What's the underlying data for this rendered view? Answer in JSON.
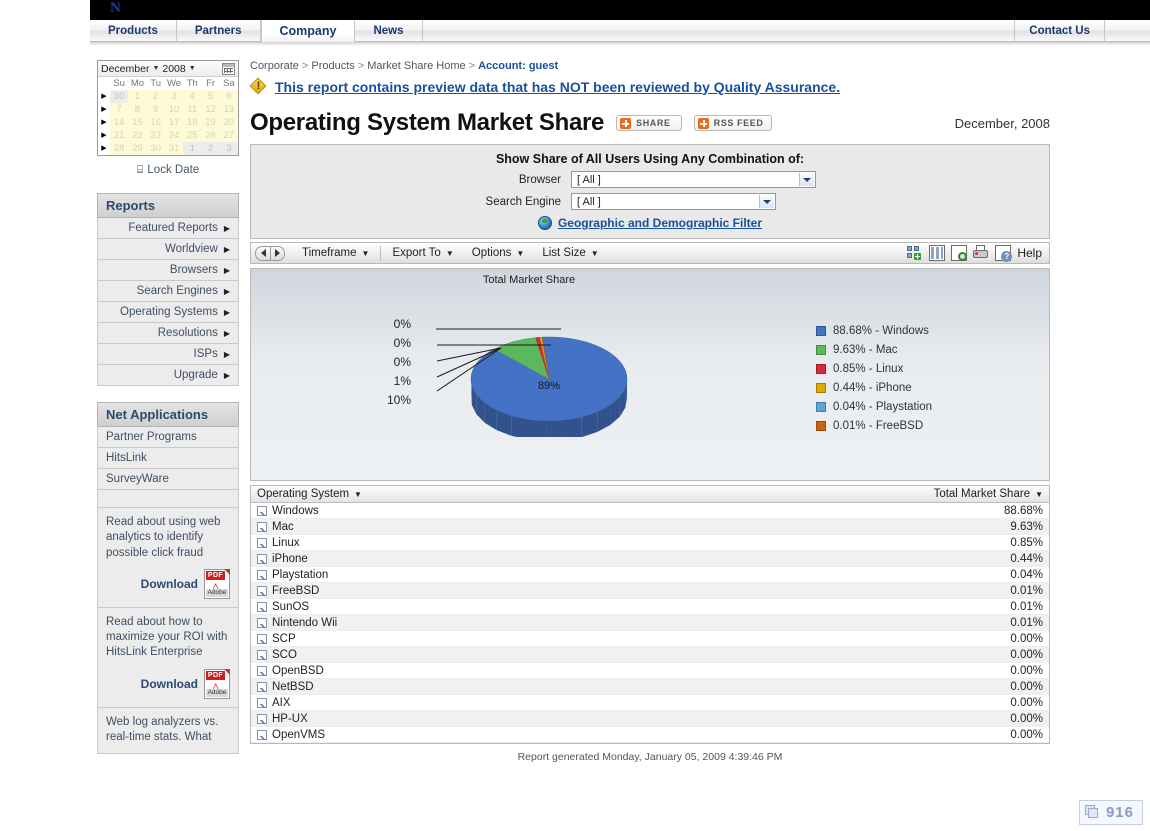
{
  "brand": {
    "logo_text": "N"
  },
  "nav": {
    "tabs": [
      {
        "label": "Products",
        "active": false
      },
      {
        "label": "Partners",
        "active": false
      },
      {
        "label": "Company",
        "active": true
      },
      {
        "label": "News",
        "active": false
      }
    ],
    "right_link": "Contact Us"
  },
  "calendar": {
    "month": "December",
    "year": "2008",
    "calendar_icon": "calendar-picker-icon",
    "dow": [
      "Su",
      "Mo",
      "Tu",
      "We",
      "Th",
      "Fr",
      "Sa"
    ],
    "weeks": [
      {
        "days": [
          {
            "d": "30",
            "out": true
          },
          {
            "d": "1",
            "out": false
          },
          {
            "d": "2",
            "out": false
          },
          {
            "d": "3",
            "out": false
          },
          {
            "d": "4",
            "out": false
          },
          {
            "d": "5",
            "out": false
          },
          {
            "d": "6",
            "out": false
          }
        ]
      },
      {
        "days": [
          {
            "d": "7",
            "out": false
          },
          {
            "d": "8",
            "out": false
          },
          {
            "d": "9",
            "out": false
          },
          {
            "d": "10",
            "out": false
          },
          {
            "d": "11",
            "out": false
          },
          {
            "d": "12",
            "out": false
          },
          {
            "d": "13",
            "out": false
          }
        ]
      },
      {
        "days": [
          {
            "d": "14",
            "out": false
          },
          {
            "d": "15",
            "out": false
          },
          {
            "d": "16",
            "out": false
          },
          {
            "d": "17",
            "out": false
          },
          {
            "d": "18",
            "out": false
          },
          {
            "d": "19",
            "out": false
          },
          {
            "d": "20",
            "out": false
          }
        ]
      },
      {
        "days": [
          {
            "d": "21",
            "out": false
          },
          {
            "d": "22",
            "out": false
          },
          {
            "d": "23",
            "out": false
          },
          {
            "d": "24",
            "out": false
          },
          {
            "d": "25",
            "out": false
          },
          {
            "d": "26",
            "out": false
          },
          {
            "d": "27",
            "out": false
          }
        ]
      },
      {
        "days": [
          {
            "d": "28",
            "out": false
          },
          {
            "d": "29",
            "out": false
          },
          {
            "d": "30",
            "out": false
          },
          {
            "d": "31",
            "out": false
          },
          {
            "d": "1",
            "out": true
          },
          {
            "d": "2",
            "out": true
          },
          {
            "d": "3",
            "out": true
          }
        ]
      }
    ],
    "lock_date_label": "Lock Date"
  },
  "sidebar": {
    "reports": {
      "title": "Reports",
      "items": [
        {
          "label": "Featured Reports"
        },
        {
          "label": "Worldview"
        },
        {
          "label": "Browsers"
        },
        {
          "label": "Search Engines"
        },
        {
          "label": "Operating Systems"
        },
        {
          "label": "Resolutions"
        },
        {
          "label": "ISPs"
        },
        {
          "label": "Upgrade"
        }
      ]
    },
    "netapps": {
      "title": "Net Applications",
      "items": [
        {
          "label": "Partner Programs"
        },
        {
          "label": "HitsLink"
        },
        {
          "label": "SurveyWare"
        }
      ]
    },
    "promos": [
      {
        "text": "Read about using web analytics to identify possible click fraud",
        "download_label": "Download",
        "pdf_tag": "PDF",
        "pdf_brand": "Adobe"
      },
      {
        "text": "Read about how to maximize your ROI with HitsLink Enterprise",
        "download_label": "Download",
        "pdf_tag": "PDF",
        "pdf_brand": "Adobe"
      }
    ],
    "promo_partial": "Web log analyzers vs. real-time stats.  What"
  },
  "breadcrumb": {
    "items": [
      "Corporate",
      "Products",
      "Market Share Home"
    ],
    "account": "Account: guest",
    "separator": ">"
  },
  "notice": {
    "icon": "warning-icon",
    "text": "This report contains preview data that has NOT been reviewed by Quality Assurance."
  },
  "header": {
    "title": "Operating System Market Share",
    "share_button": "SHARE",
    "rss_button": "RSS FEED",
    "date_label": "December, 2008"
  },
  "filter": {
    "title": "Show Share of All Users Using Any Combination of:",
    "browser_label": "Browser",
    "browser_value": "[ All ]",
    "search_engine_label": "Search Engine",
    "search_engine_value": "[ All ]",
    "geo_link": "Geographic and Demographic Filter"
  },
  "toolbar": {
    "prev_icon": "arrow-left-icon",
    "next_icon": "arrow-right-icon",
    "menus": [
      {
        "label": "Timeframe"
      },
      {
        "label": "Export To"
      },
      {
        "label": "Options"
      },
      {
        "label": "List Size"
      }
    ],
    "help_label": "Help",
    "icons": [
      "add-widget-icon",
      "columns-icon",
      "preview-icon",
      "print-icon",
      "help-icon"
    ]
  },
  "chart_data": {
    "type": "pie",
    "title": "Total Market Share",
    "xlabel": "",
    "ylabel": "",
    "legend_position": "right",
    "grid": false,
    "categories": [
      "Windows",
      "Mac",
      "Linux",
      "iPhone",
      "Playstation",
      "FreeBSD"
    ],
    "values": [
      88.68,
      9.63,
      0.85,
      0.44,
      0.04,
      0.01
    ],
    "colors": [
      "#4472c4",
      "#5cb85c",
      "#d2293f",
      "#e0a800",
      "#57a6d8",
      "#d2620a"
    ],
    "legend": [
      "88.68% - Windows",
      "9.63% - Mac",
      "0.85% - Linux",
      "0.44% - iPhone",
      "0.04% - Playstation",
      "0.01% - FreeBSD"
    ],
    "slice_labels": [
      "89%",
      "10%",
      "1%",
      "0%",
      "0%",
      "0%"
    ],
    "callout_labels": [
      "0%",
      "0%",
      "0%",
      "1%",
      "10%"
    ],
    "inside_label": "89%"
  },
  "table": {
    "col_os": "Operating System",
    "col_share": "Total Market Share",
    "rows": [
      {
        "name": "Windows",
        "share": "88.68%"
      },
      {
        "name": "Mac",
        "share": "9.63%"
      },
      {
        "name": "Linux",
        "share": "0.85%"
      },
      {
        "name": "iPhone",
        "share": "0.44%"
      },
      {
        "name": "Playstation",
        "share": "0.04%"
      },
      {
        "name": "FreeBSD",
        "share": "0.01%"
      },
      {
        "name": "SunOS",
        "share": "0.01%"
      },
      {
        "name": "Nintendo Wii",
        "share": "0.01%"
      },
      {
        "name": "SCP",
        "share": "0.00%"
      },
      {
        "name": "SCO",
        "share": "0.00%"
      },
      {
        "name": "OpenBSD",
        "share": "0.00%"
      },
      {
        "name": "NetBSD",
        "share": "0.00%"
      },
      {
        "name": "AIX",
        "share": "0.00%"
      },
      {
        "name": "HP-UX",
        "share": "0.00%"
      },
      {
        "name": "OpenVMS",
        "share": "0.00%"
      }
    ],
    "generated": "Report generated Monday, January 05, 2009 4:39:46 PM"
  },
  "counter": {
    "value": "916",
    "icon": "stack-icon"
  }
}
